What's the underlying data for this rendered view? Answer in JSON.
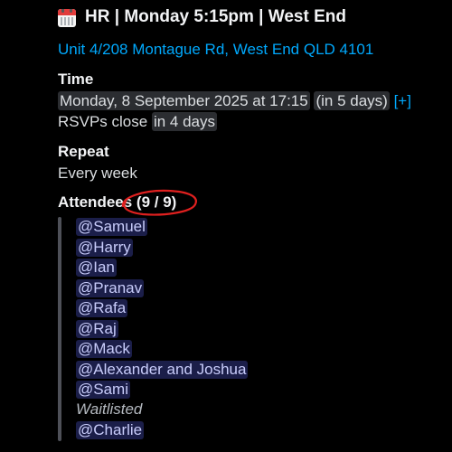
{
  "event": {
    "title": "HR | Monday 5:15pm | West End",
    "icon": "calendar-icon",
    "address": "Unit 4/208 Montague Rd, West End QLD 4101"
  },
  "time": {
    "label": "Time",
    "datetime": "Monday, 8 September 2025 at 17:15",
    "relative": "in 5 days",
    "add_link": "[+]",
    "rsvp_prefix": "RSVPs close",
    "rsvp_relative": "in 4 days"
  },
  "repeat": {
    "label": "Repeat",
    "value": "Every week"
  },
  "attendees": {
    "label": "Attendees",
    "count": "(9 / 9)",
    "annotation_color": "#e0201f",
    "list": [
      "@Samuel",
      "@Harry",
      "@Ian",
      "@Pranav",
      "@Rafa",
      "@Raj",
      "@Mack",
      "@Alexander and Joshua",
      "@Sami"
    ],
    "waitlisted_label": "Waitlisted",
    "waitlist": [
      "@Charlie"
    ]
  },
  "colors": {
    "background": "#000000",
    "link": "#00a8fc",
    "mention_bg": "rgba(88,101,242,0.30)",
    "mention_text": "#c9cdfb"
  }
}
